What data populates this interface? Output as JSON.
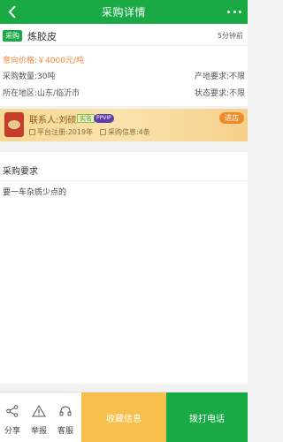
{
  "header": {
    "title": "采购详情"
  },
  "listing": {
    "tag": "采购",
    "product_name": "炼胶皮",
    "time_ago": "5分钟前",
    "price_label": "意向价格:",
    "price_value": "￥4000元/吨",
    "quantity_label": "采购数量:",
    "quantity_value": "30吨",
    "origin_label": "产地要求:",
    "origin_value": "不限",
    "region_label": "所在地区:",
    "region_value": "山东/临沂市",
    "condition_label": "状态要求:",
    "condition_value": "不限"
  },
  "contact": {
    "name": "联系人:刘硕",
    "verified_badge": "实名",
    "vip_badge": "PPVIP",
    "registered": "平台注册:2019年",
    "purchase_count": "采购信息:4条",
    "enter_label": "进店"
  },
  "requirements": {
    "title": "采购要求",
    "content": "要一车杂质少点的"
  },
  "bottom_bar": {
    "share_label": "分享",
    "report_label": "举报",
    "service_label": "客服",
    "favorite_label": "收藏信息",
    "call_label": "拨打电话"
  },
  "colors": {
    "brand_green": "#1aaa45",
    "price_orange": "#f0883a",
    "favorite_yellow": "#f7c04c",
    "enter_orange": "#f08b2c"
  },
  "icons": {
    "back": "chevron-left-icon",
    "more": "more-dots-icon",
    "share": "share-icon",
    "report": "warning-icon",
    "service": "headset-icon"
  }
}
